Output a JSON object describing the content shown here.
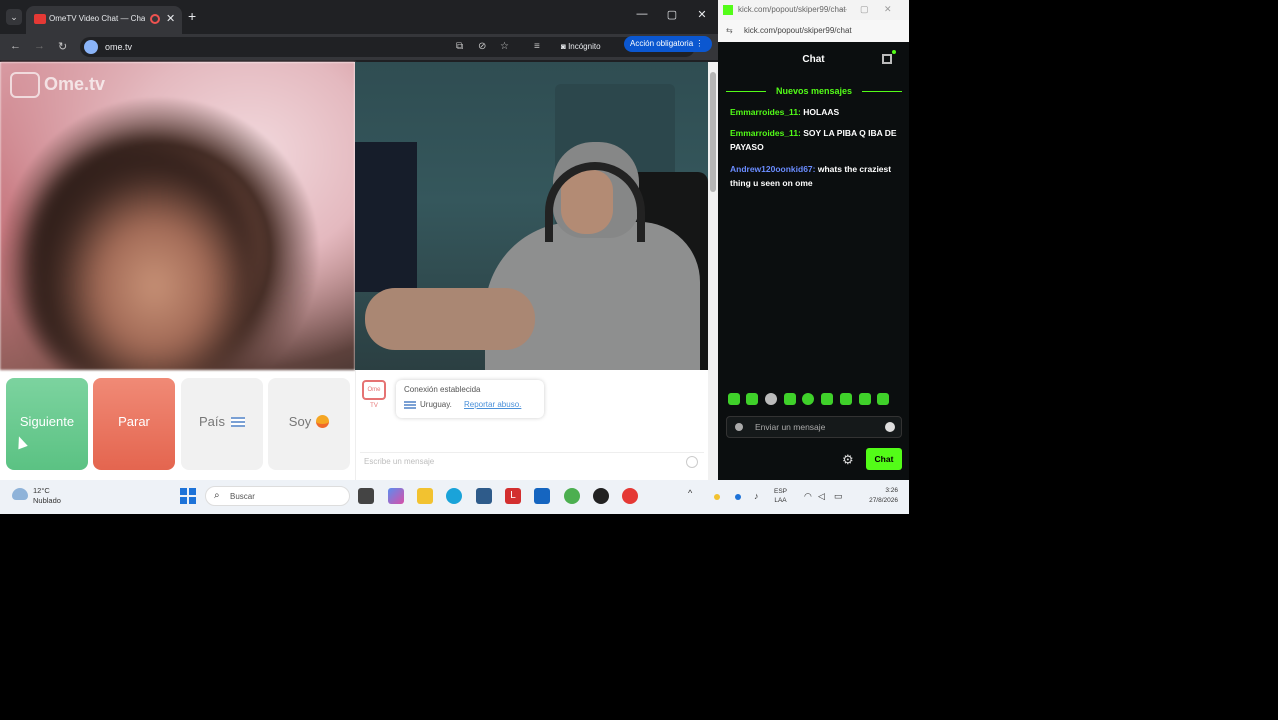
{
  "browser": {
    "tab_title": "OmeTV Video Chat — Cha…",
    "tab_list_glyph": "⌄",
    "close_glyph": "✕",
    "new_tab_glyph": "+",
    "window_buttons": [
      "—",
      "▢",
      "✕"
    ],
    "nav": {
      "back": "←",
      "forward": "→",
      "reload": "↻"
    },
    "url": "ome.tv",
    "incognito_label": "Incógnito",
    "action_chip_label": "Acción obligatoria",
    "menu_glyph": "⋮",
    "toolbar_icons": [
      "translate-icon",
      "eye-off-icon",
      "star-icon",
      "tab-search-icon"
    ]
  },
  "ometv": {
    "brand": "Ome.tv",
    "buttons": {
      "next": "Siguiente",
      "stop": "Parar",
      "country": "País",
      "me": "Soy"
    },
    "system_message": {
      "logo": "Ome TV",
      "line1": "Conexión establecida",
      "country": "Uruguay.",
      "report_link": "Reportar abuso."
    },
    "message_placeholder": "Escribe un mensaje"
  },
  "kick": {
    "title_bar": "kick.com/popout/skiper99/chat",
    "window_buttons": [
      "—",
      "▢",
      "✕"
    ],
    "url": "kick.com/popout/skiper99/chat",
    "header_title": "Chat",
    "new_messages_label": "Nuevos mensajes",
    "messages": [
      {
        "user": "Emmarroides_11",
        "sep": ": ",
        "text": "HOLAAS",
        "color": "#53fc18"
      },
      {
        "user": "Emmarroides_11",
        "sep": ": ",
        "text": "SOY LA PIBA Q IBA DE PAYASO",
        "color": "#53fc18"
      },
      {
        "user": "Andrew120oonkid67",
        "sep": ": ",
        "text": "whats the craziest thing u seen on ome",
        "color": "#6a8cff"
      }
    ],
    "input_placeholder": "Enviar un mensaje",
    "send_label": "Chat",
    "gear_glyph": "⚙",
    "accent": "#53fc18"
  },
  "taskbar": {
    "weather_temp": "12°C",
    "weather_desc": "Nublado",
    "search_label": "Buscar",
    "search_glyph": "⌕",
    "tray_up": "^",
    "lang_top": "ESP",
    "lang_bottom": "LAA",
    "time": "3:26",
    "date": "27/8/2026"
  }
}
